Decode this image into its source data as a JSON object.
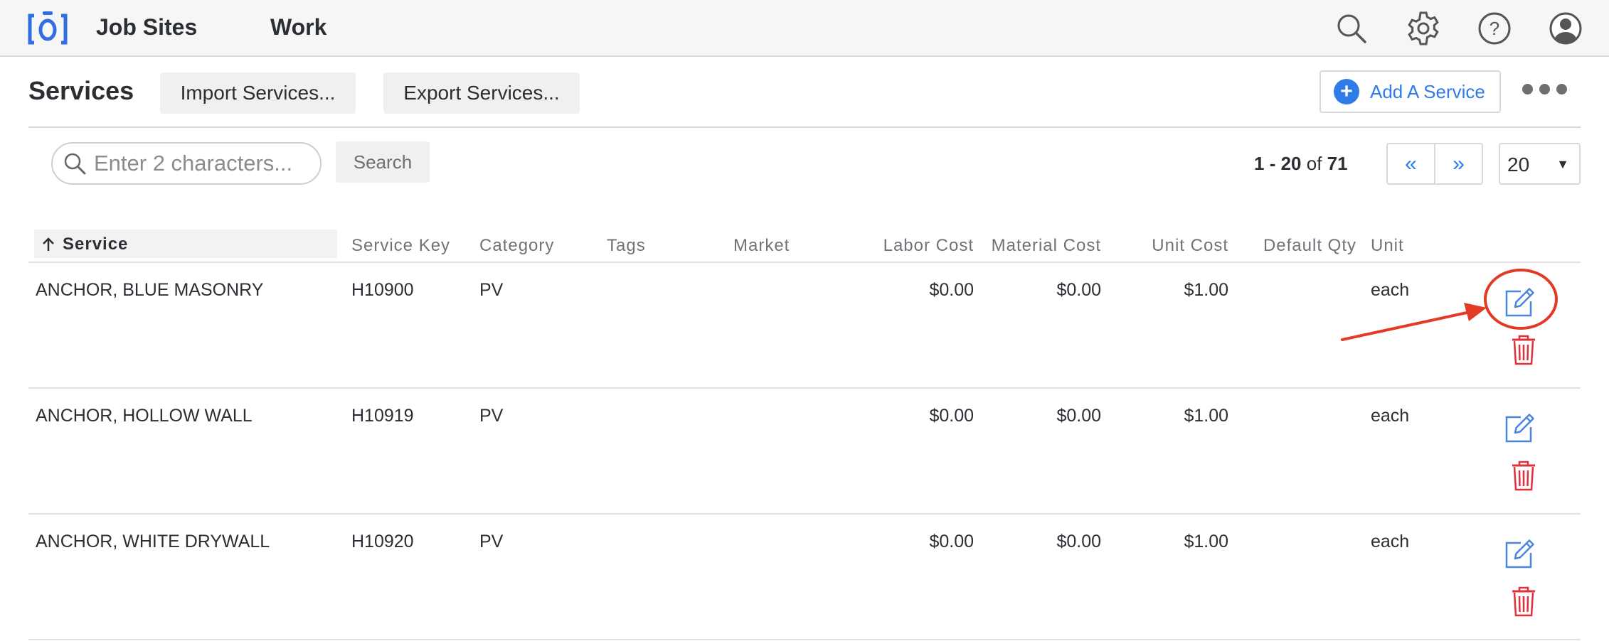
{
  "nav": {
    "logo_icon": "camera-brand-logo",
    "links": [
      {
        "label": "Job Sites"
      },
      {
        "label": "Work"
      }
    ],
    "icons": [
      "search-icon",
      "gear-icon",
      "help-icon",
      "user-avatar-icon"
    ]
  },
  "header": {
    "title": "Services",
    "import_label": "Import Services...",
    "export_label": "Export Services...",
    "add_label": "Add A Service",
    "add_icon": "plus-circle-icon",
    "more_icon": "more-dots-icon"
  },
  "search": {
    "placeholder": "Enter 2 characters...",
    "value": "",
    "button_label": "Search"
  },
  "pagination": {
    "range_start": "1",
    "range_end": "20",
    "of_label": "of",
    "total": "71",
    "prev_label": "«",
    "next_label": "»",
    "per_page": "20"
  },
  "table": {
    "columns": {
      "service": "Service",
      "service_key": "Service Key",
      "category": "Category",
      "tags": "Tags",
      "market": "Market",
      "labor_cost": "Labor Cost",
      "material_cost": "Material Cost",
      "unit_cost": "Unit Cost",
      "default_qty": "Default Qty",
      "unit": "Unit"
    },
    "sort": {
      "column": "service",
      "direction": "ascending",
      "icon": "sort-up-arrow-icon"
    },
    "rows": [
      {
        "service": "ANCHOR, BLUE MASONRY",
        "service_key": "H10900",
        "category": "PV",
        "tags": "",
        "market": "",
        "labor_cost": "$0.00",
        "material_cost": "$0.00",
        "unit_cost": "$1.00",
        "default_qty": "",
        "unit": "each"
      },
      {
        "service": "ANCHOR, HOLLOW WALL",
        "service_key": "H10919",
        "category": "PV",
        "tags": "",
        "market": "",
        "labor_cost": "$0.00",
        "material_cost": "$0.00",
        "unit_cost": "$1.00",
        "default_qty": "",
        "unit": "each"
      },
      {
        "service": "ANCHOR, WHITE DRYWALL",
        "service_key": "H10920",
        "category": "PV",
        "tags": "",
        "market": "",
        "labor_cost": "$0.00",
        "material_cost": "$0.00",
        "unit_cost": "$1.00",
        "default_qty": "",
        "unit": "each"
      }
    ],
    "row_icons": [
      "edit-icon",
      "trash-icon"
    ]
  },
  "annotation": {
    "highlight": "first-row-edit-icon",
    "color": "#e23b25"
  },
  "colors": {
    "accent": "#2f7be8",
    "danger": "#e0303a",
    "text": "#2b2f33",
    "muted": "#6f7378",
    "topbar_bg": "#f6f6f6"
  }
}
